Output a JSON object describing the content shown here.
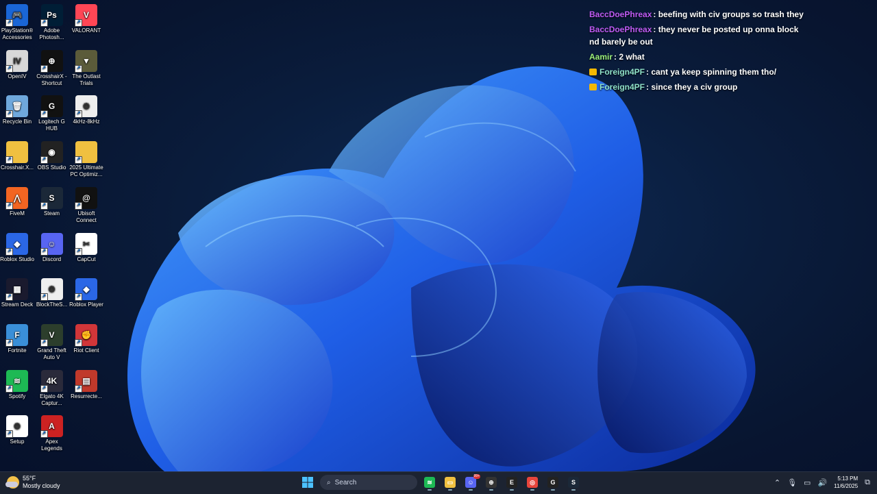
{
  "desktop_icons": [
    {
      "label": "PlayStation® Accessories",
      "color": "#1a66d6",
      "glyph": "🎮",
      "col": 0,
      "row": 0
    },
    {
      "label": "Adobe Photosh...",
      "color": "#001e36",
      "glyph": "Ps",
      "col": 1,
      "row": 0
    },
    {
      "label": "VALORANT",
      "color": "#ff4655",
      "glyph": "V",
      "col": 2,
      "row": 0
    },
    {
      "label": "OpenIV",
      "color": "#d8d8d8",
      "glyph": "IV",
      "col": 0,
      "row": 1
    },
    {
      "label": "CrosshairX - Shortcut",
      "color": "#111111",
      "glyph": "⊕",
      "col": 1,
      "row": 1
    },
    {
      "label": "The Outlast Trials",
      "color": "#5b5b3a",
      "glyph": "▼",
      "col": 2,
      "row": 1
    },
    {
      "label": "Recycle Bin",
      "color": "#6fa8dc",
      "glyph": "🗑",
      "col": 0,
      "row": 2
    },
    {
      "label": "Logitech G HUB",
      "color": "#111111",
      "glyph": "G",
      "col": 1,
      "row": 2
    },
    {
      "label": "4kHz-8kHz",
      "color": "#eeeeee",
      "glyph": "⚙",
      "col": 2,
      "row": 2
    },
    {
      "label": "Crosshair.X...",
      "color": "#f0c040",
      "glyph": "",
      "col": 0,
      "row": 3
    },
    {
      "label": "OBS Studio",
      "color": "#222222",
      "glyph": "◉",
      "col": 1,
      "row": 3
    },
    {
      "label": "2025 Ultimate PC Optimiz...",
      "color": "#f0c040",
      "glyph": "",
      "col": 2,
      "row": 3
    },
    {
      "label": "FiveM",
      "color": "#f26522",
      "glyph": "⋀",
      "col": 0,
      "row": 4
    },
    {
      "label": "Steam",
      "color": "#1b2838",
      "glyph": "S",
      "col": 1,
      "row": 4
    },
    {
      "label": "Ubisoft Connect",
      "color": "#111111",
      "glyph": "@",
      "col": 2,
      "row": 4
    },
    {
      "label": "Roblox Studio",
      "color": "#2b67e6",
      "glyph": "◆",
      "col": 0,
      "row": 5
    },
    {
      "label": "Discord",
      "color": "#5865f2",
      "glyph": "☺",
      "col": 1,
      "row": 5
    },
    {
      "label": "CapCut",
      "color": "#ffffff",
      "glyph": "✂",
      "col": 2,
      "row": 5
    },
    {
      "label": "Stream Deck",
      "color": "#1a1a2e",
      "glyph": "▦",
      "col": 0,
      "row": 6
    },
    {
      "label": "BlockTheS...",
      "color": "#eeeeee",
      "glyph": "⚙",
      "col": 1,
      "row": 6
    },
    {
      "label": "Roblox Player",
      "color": "#2b67e6",
      "glyph": "◆",
      "col": 2,
      "row": 6
    },
    {
      "label": "Fortnite",
      "color": "#3a8fd8",
      "glyph": "F",
      "col": 0,
      "row": 7
    },
    {
      "label": "Grand Theft Auto V",
      "color": "#2c3e2c",
      "glyph": "V",
      "col": 1,
      "row": 7
    },
    {
      "label": "Riot Client",
      "color": "#d13639",
      "glyph": "✊",
      "col": 2,
      "row": 7
    },
    {
      "label": "Spotify",
      "color": "#1db954",
      "glyph": "≋",
      "col": 0,
      "row": 8
    },
    {
      "label": "Elgato 4K Captur...",
      "color": "#2a2a3a",
      "glyph": "4K",
      "col": 1,
      "row": 8
    },
    {
      "label": "Resurrecte...",
      "color": "#c0392b",
      "glyph": "▤",
      "col": 2,
      "row": 8
    },
    {
      "label": "Setup",
      "color": "#ffffff",
      "glyph": "⚙",
      "col": 0,
      "row": 9
    },
    {
      "label": "Apex Legends",
      "color": "#cc2222",
      "glyph": "A",
      "col": 1,
      "row": 9
    }
  ],
  "chat": [
    {
      "user": "BaccDoePhreax",
      "color": "#c05bf5",
      "badge": false,
      "message": ": beefing with civ groups so trash they"
    },
    {
      "user": "BaccDoePhreax",
      "color": "#c05bf5",
      "badge": false,
      "message": ": they never be posted up onna block nd barely be out"
    },
    {
      "user": "Aamir",
      "color": "#9cf07a",
      "badge": false,
      "message": ": 2 what"
    },
    {
      "user": "Foreign4PF",
      "color": "#8fe0c8",
      "badge": true,
      "message": ": cant ya keep spinning them tho/"
    },
    {
      "user": "Foreign4PF",
      "color": "#8fe0c8",
      "badge": true,
      "message": ": since they a civ group"
    }
  ],
  "taskbar": {
    "weather_temp": "55°F",
    "weather_desc": "Mostly cloudy",
    "search_label": "Search",
    "apps": [
      {
        "name": "spotify-taskbar-icon",
        "color": "#1db954",
        "glyph": "≋"
      },
      {
        "name": "file-explorer-taskbar-icon",
        "color": "#f0c040",
        "glyph": "▭"
      },
      {
        "name": "discord-taskbar-icon",
        "color": "#5865f2",
        "glyph": "☺",
        "badge": "99+"
      },
      {
        "name": "crosshairx-taskbar-icon",
        "color": "#333333",
        "glyph": "⊕"
      },
      {
        "name": "epic-games-taskbar-icon",
        "color": "#222222",
        "glyph": "E"
      },
      {
        "name": "chrome-taskbar-icon",
        "color": "#e8453c",
        "glyph": "◎"
      },
      {
        "name": "logitech-taskbar-icon",
        "color": "#222222",
        "glyph": "G"
      },
      {
        "name": "steam-taskbar-icon",
        "color": "#1b2838",
        "glyph": "S"
      }
    ],
    "time": "5:13 PM",
    "date": "11/6/2025"
  }
}
